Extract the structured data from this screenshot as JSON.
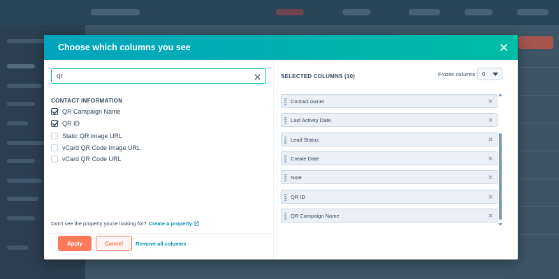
{
  "modal": {
    "title": "Choose which columns you see"
  },
  "search": {
    "value": "qr",
    "placeholder": ""
  },
  "contact_information": {
    "heading": "CONTACT INFORMATION",
    "options": [
      {
        "label": "QR Campaign Name",
        "checked": true
      },
      {
        "label": "QR ID",
        "checked": true
      },
      {
        "label": "Static QR image URL",
        "checked": false
      },
      {
        "label": "vCard QR Code Image URL",
        "checked": false
      },
      {
        "label": "vCard QR Code URL",
        "checked": false
      }
    ]
  },
  "hint": {
    "text": "Don't see the property you're looking for?",
    "link": "Create a property"
  },
  "footer": {
    "apply_label": "Apply",
    "cancel_label": "Cancel",
    "remove_all_label": "Remove all columns"
  },
  "selected": {
    "heading": "SELECTED COLUMNS (10)",
    "frozen_label": "Frozen columns",
    "frozen_value": "0",
    "items": [
      "Contact owner",
      "Last Activity Date",
      "Lead Status",
      "Create Date",
      "Note",
      "QR ID",
      "QR Campaign Name"
    ]
  },
  "colors": {
    "header_start": "#00a4bd",
    "header_end": "#00bda5",
    "primary_button": "#ff7a59",
    "link": "#0091ae",
    "text": "#33475b"
  },
  "icons": {
    "close": "close-icon",
    "clear": "clear-icon",
    "external": "external-link-icon",
    "checkmark": "check-icon",
    "drag": "drag-handle-icon",
    "caret": "caret-down-icon"
  }
}
